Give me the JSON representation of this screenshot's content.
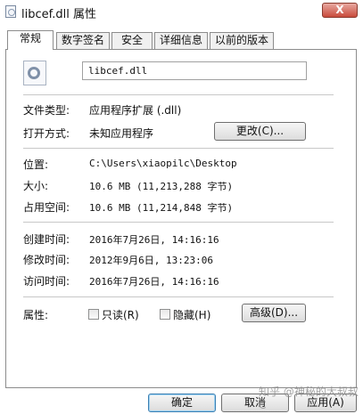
{
  "window": {
    "title": "libcef.dll 属性",
    "close_symbol": "X"
  },
  "tabs": [
    {
      "label": "常规"
    },
    {
      "label": "数字签名"
    },
    {
      "label": "安全"
    },
    {
      "label": "详细信息"
    },
    {
      "label": "以前的版本"
    }
  ],
  "file": {
    "name": "libcef.dll"
  },
  "type": {
    "label": "文件类型:",
    "value": "应用程序扩展 (.dll)"
  },
  "open_with": {
    "label": "打开方式:",
    "value": "未知应用程序",
    "button": "更改(C)..."
  },
  "location": {
    "label": "位置:",
    "value": "C:\\Users\\xiaopilc\\Desktop"
  },
  "size": {
    "label": "大小:",
    "value": "10.6 MB (11,213,288 字节)"
  },
  "size_on_disk": {
    "label": "占用空间:",
    "value": "10.6 MB (11,214,848 字节)"
  },
  "created": {
    "label": "创建时间:",
    "value": "2016年7月26日, 14:16:16"
  },
  "modified": {
    "label": "修改时间:",
    "value": "2012年9月6日, 13:23:06"
  },
  "accessed": {
    "label": "访问时间:",
    "value": "2016年7月26日, 14:16:16"
  },
  "attributes": {
    "label": "属性:",
    "readonly": {
      "label": "只读(R)",
      "checked": false
    },
    "hidden": {
      "label": "隐藏(H)",
      "checked": false
    },
    "advanced_button": "高级(D)..."
  },
  "footer": {
    "ok": "确定",
    "cancel": "取消",
    "apply": "应用(A)"
  },
  "watermark": "知乎 @神秘的大叔叔C"
}
